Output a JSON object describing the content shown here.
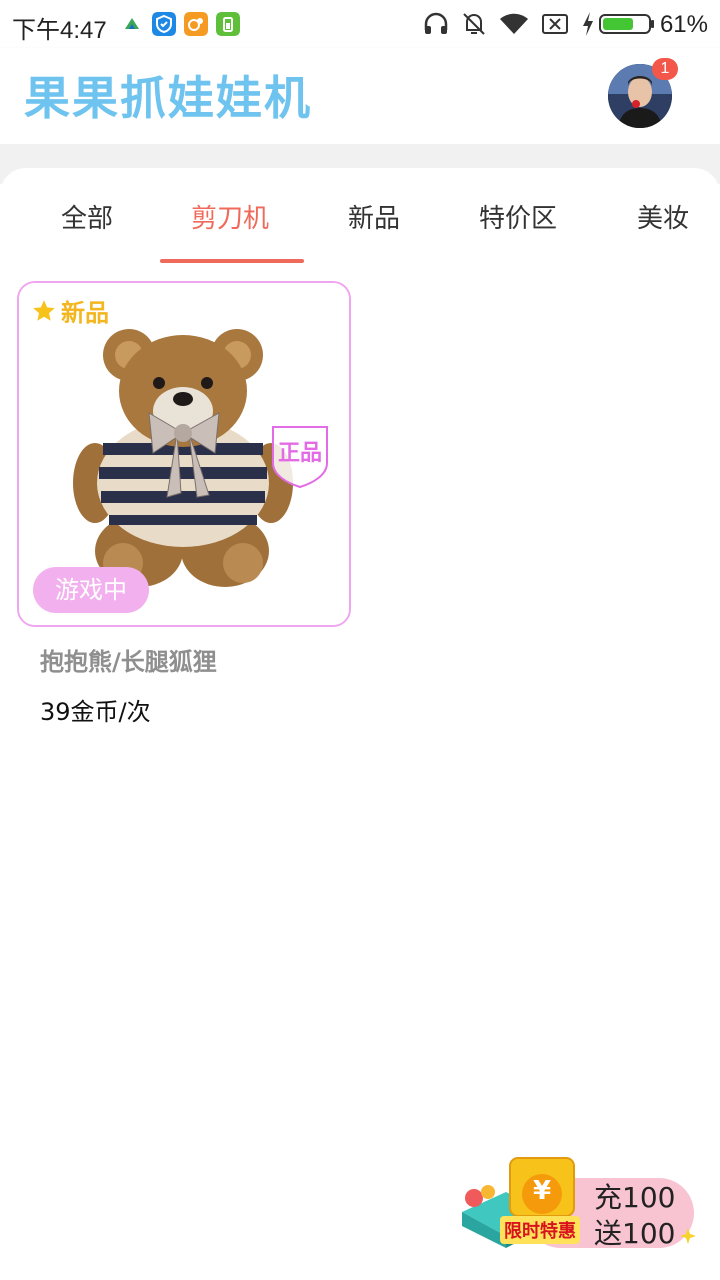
{
  "status_bar": {
    "time": "下午4:47",
    "battery": "61%",
    "icons": [
      "sim-app-icon",
      "shield-app-icon",
      "squirrel-app-icon",
      "battery-app-icon",
      "headphones-icon",
      "mute-bell-icon",
      "wifi-icon",
      "no-sim-icon",
      "charging-icon",
      "battery-icon"
    ]
  },
  "header": {
    "title": "果果抓娃娃机",
    "notification_count": "1"
  },
  "tabs": [
    {
      "label": "全部",
      "active": false
    },
    {
      "label": "剪刀机",
      "active": true
    },
    {
      "label": "新品",
      "active": false
    },
    {
      "label": "特价区",
      "active": false
    },
    {
      "label": "美妆",
      "active": false
    }
  ],
  "products": [
    {
      "tag_new": "新品",
      "tag_genuine": "正品",
      "status": "游戏中",
      "name": "抱抱熊/长腿狐狸",
      "price": "39金币/次"
    }
  ],
  "promo": {
    "line1": "充100",
    "line2": "送100",
    "label": "限时特惠",
    "symbol": "¥"
  },
  "colors": {
    "accent": "#ef6a5a",
    "card_border": "#f0a6ef",
    "playing_badge": "#f2b0ee",
    "title_blue": "#6fc3ef",
    "new_tag": "#f3b61f"
  }
}
